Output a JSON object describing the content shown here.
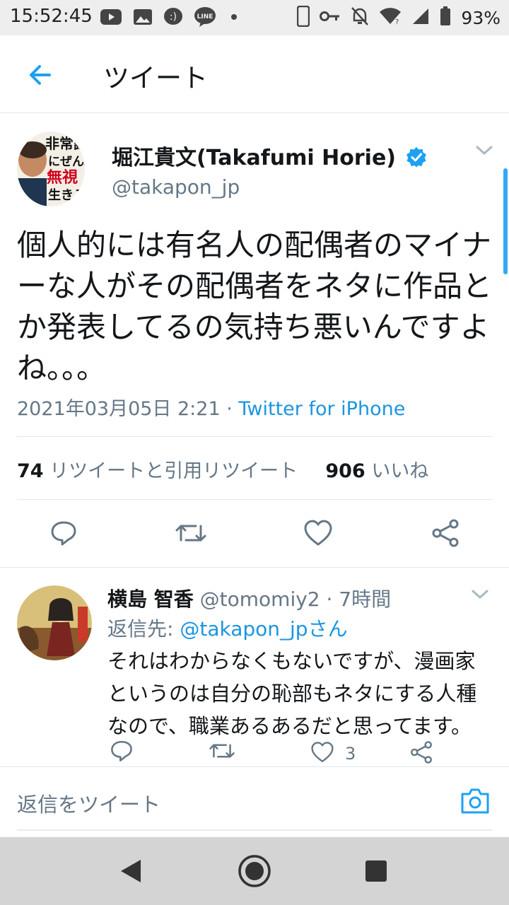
{
  "status_bar": {
    "time": "15:52:45",
    "battery_pct": "93%",
    "line_label": "LINE",
    "icons": [
      "youtube-icon",
      "gallery-icon",
      "messenger-icon",
      "line-icon",
      "dot-icon",
      "phone-icon",
      "key-icon",
      "mute-icon",
      "wifi-icon",
      "signal-icon",
      "battery-icon"
    ]
  },
  "header": {
    "title": "ツイート",
    "back_icon": "arrow-left-icon"
  },
  "tweet": {
    "author_name": "堀江貴文(Takafumi Horie)",
    "author_handle": "@takapon_jp",
    "verified": true,
    "text": "個人的には有名人の配偶者のマイナーな人がその配偶者をネタに作品とか発表してるの気持ち悪いんですよね。。。",
    "timestamp": "2021年03月05日 2:21 · ",
    "source": "Twitter for iPhone",
    "avatar_text": {
      "line1": "非常識",
      "line2": "にぜんぶ",
      "line3": "無視",
      "line4": "生きろ"
    },
    "retweet_count": "74",
    "retweet_label": " リツイートと引用リツイート",
    "like_count": "906",
    "like_label": " いいね"
  },
  "reply": {
    "author_name": "横島 智香",
    "author_handle": " @tomomiy2 · 7時間",
    "reply_to_prefix": "返信先: ",
    "reply_to_link": "@takapon_jpさん",
    "text": "それはわからなくもないですが、漫画家というのは自分の恥部もネタにする人種なので、職業あるあるだと思ってます。",
    "like_count": "3"
  },
  "compose": {
    "placeholder": "返信をツイート"
  },
  "colors": {
    "accent": "#1da1f2",
    "link": "#1b95e0",
    "secondary_text": "#657786",
    "primary_text": "#14171a",
    "divider": "#e1e8ed"
  }
}
